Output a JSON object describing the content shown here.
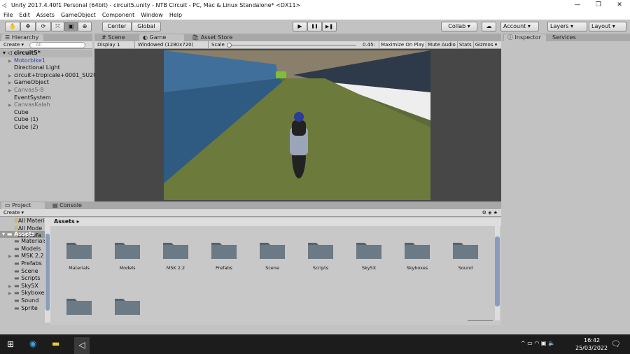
{
  "window": {
    "title": "Unity 2017.4.40f1 Personal (64bit) - circuit5.unity - NTB Circuit - PC, Mac & Linux Standalone* <DX11>",
    "controls": [
      "—",
      "❐",
      "✕"
    ]
  },
  "menu": [
    "File",
    "Edit",
    "Assets",
    "GameObject",
    "Component",
    "Window",
    "Help"
  ],
  "toolbar": {
    "tools": [
      "hand",
      "move",
      "rotate",
      "scale",
      "rect",
      "transform"
    ],
    "pivot": "Center",
    "space": "Global",
    "play": "▶",
    "pause": "❚❚",
    "step": "▶❚",
    "collab": "Collab ▾",
    "account": "Account",
    "layers": "Layers",
    "layout": "Layout"
  },
  "hierarchy": {
    "tab": "Hierarchy",
    "create": "Create ▾",
    "search_placeholder": "All",
    "scene": "circuit5*",
    "items": [
      {
        "label": "Motorbike1",
        "arrow": true,
        "color": "#2c3cae"
      },
      {
        "label": "Directional Light",
        "arrow": false
      },
      {
        "label": "circuit+tropicale+0001_SU20",
        "arrow": true
      },
      {
        "label": "GameObject",
        "arrow": true
      },
      {
        "label": "Canvas5-8",
        "arrow": true,
        "color": "#666"
      },
      {
        "label": "EventSystem",
        "arrow": false
      },
      {
        "label": "CanvasKalah",
        "arrow": true,
        "color": "#666"
      },
      {
        "label": "Cube",
        "arrow": false
      },
      {
        "label": "Cube (1)",
        "arrow": false
      },
      {
        "label": "Cube (2)",
        "arrow": false
      }
    ]
  },
  "center": {
    "tabs": [
      "Scene",
      "Game",
      "Asset Store"
    ],
    "active": "Game",
    "display": "Display 1",
    "resolution": "Windowed (1280x720)",
    "scale_label": "Scale",
    "scale_value": "0.45:",
    "scale_fraction": 0.45,
    "options": [
      "Maximize On Play",
      "Mute Audio",
      "Stats",
      "Gizmos"
    ]
  },
  "inspector": {
    "tabs": [
      "Inspector",
      "Services"
    ]
  },
  "project": {
    "tabs": [
      "Project",
      "Console"
    ],
    "create": "Create ▾",
    "favorites": [
      "All Materi",
      "All Mode",
      "All Prefa"
    ],
    "root": "Assets",
    "tree": [
      {
        "label": "Materials",
        "arrow": false
      },
      {
        "label": "Models",
        "arrow": false
      },
      {
        "label": "MSK 2.2",
        "arrow": true
      },
      {
        "label": "Prefabs",
        "arrow": false
      },
      {
        "label": "Scene",
        "arrow": false
      },
      {
        "label": "Scripts",
        "arrow": false
      },
      {
        "label": "Sky5X",
        "arrow": true
      },
      {
        "label": "Skyboxes",
        "arrow": true
      },
      {
        "label": "Sound",
        "arrow": false
      },
      {
        "label": "Sprite",
        "arrow": false
      }
    ],
    "breadcrumb": "Assets ▸",
    "folders": [
      "Materials",
      "Models",
      "MSK 2.2",
      "Prefabs",
      "Scene",
      "Scripts",
      "Sky5X",
      "Skyboxes",
      "Sound",
      "",
      ""
    ]
  },
  "taskbar": {
    "time": "16:42",
    "date": "25/03/2022"
  }
}
